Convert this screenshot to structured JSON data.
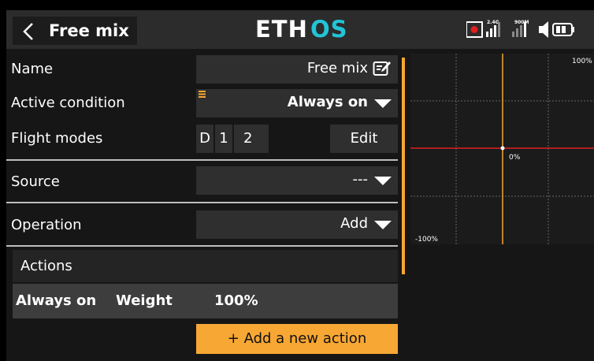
{
  "header": {
    "title": "Free mix",
    "logo_text": "ETHOS",
    "signal_labels": [
      "2.4G",
      "900M"
    ]
  },
  "form": {
    "name_label": "Name",
    "name_value": "Free mix",
    "active_condition_label": "Active condition",
    "active_condition_value": "Always on",
    "flight_modes_label": "Flight modes",
    "flight_modes": [
      "D",
      "1",
      "2"
    ],
    "flight_modes_edit": "Edit",
    "source_label": "Source",
    "source_value": "---",
    "operation_label": "Operation",
    "operation_value": "Add"
  },
  "actions": {
    "header": "Actions",
    "rows": [
      {
        "condition": "Always on",
        "weight_label": "Weight",
        "weight_value": "100%"
      }
    ],
    "add_button": "+ Add a new action"
  },
  "graph": {
    "max_label": "100%",
    "min_label": "-100%",
    "center_label": "0%",
    "colors": {
      "vertical_axis": "#f7a733",
      "horizontal_axis": "#e02020",
      "grid": "#666666",
      "point": "#ffffff"
    }
  },
  "colors": {
    "accent": "#f7a733",
    "record_indicator": "#e02020"
  }
}
